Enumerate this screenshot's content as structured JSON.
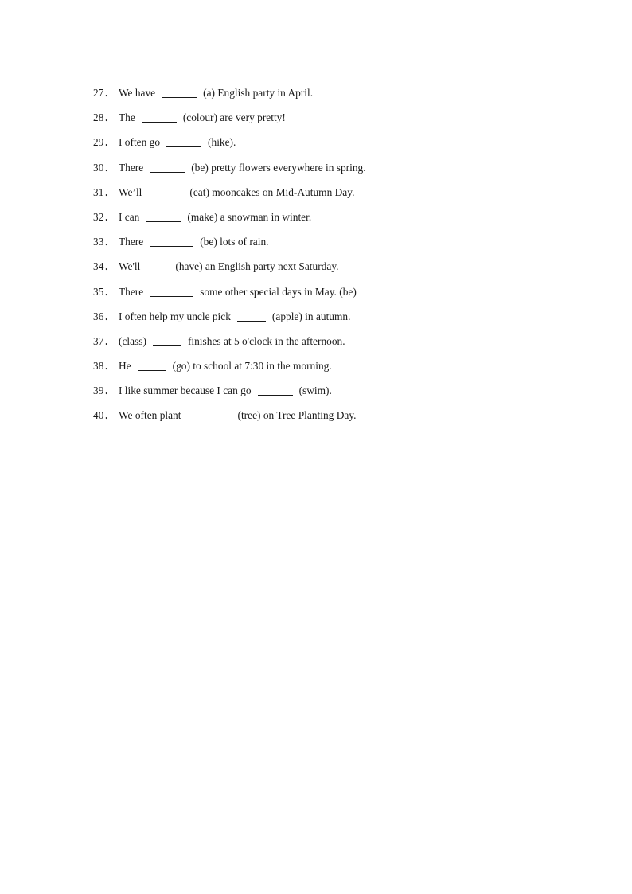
{
  "document": {
    "type": "worksheet",
    "page_background": "#ffffff",
    "text_color": "#1a1a1a",
    "exercises": [
      {
        "number": "27",
        "number_label": "27．",
        "before_blank": "We have",
        "blank_size": "lg",
        "after_blank": "(a) English party in April.",
        "full_text": "27．We have _____ (a) English party in April."
      },
      {
        "number": "28",
        "number_label": "28．",
        "before_blank": "The",
        "blank_size": "lg",
        "after_blank": "(colour) are very pretty!",
        "full_text": "28．The _____ (colour) are very pretty!"
      },
      {
        "number": "29",
        "number_label": "29．",
        "before_blank": "I often go",
        "blank_size": "lg",
        "after_blank": "(hike).",
        "full_text": "29．I often go _____ (hike)."
      },
      {
        "number": "30",
        "number_label": "30．",
        "before_blank": "There",
        "blank_size": "lg",
        "after_blank": "(be) pretty flowers everywhere in spring.",
        "full_text": "30．There _____ (be) pretty flowers everywhere in spring."
      },
      {
        "number": "31",
        "number_label": "31．",
        "before_blank": "We’ll",
        "blank_size": "lg",
        "after_blank": "(eat) mooncakes on Mid-Autumn Day.",
        "full_text": "31．We’ll _____ (eat) mooncakes on Mid-Autumn Day."
      },
      {
        "number": "32",
        "number_label": "32．",
        "before_blank": "I can",
        "blank_size": "lg",
        "after_blank": "(make) a snowman in winter.",
        "full_text": "32．I can _____ (make) a snowman in winter."
      },
      {
        "number": "33",
        "number_label": "33．",
        "before_blank": "There",
        "blank_size": "xl",
        "after_blank": "(be) lots of rain.",
        "full_text": "33．There _______ (be) lots of rain."
      },
      {
        "number": "34",
        "number_label": "34．",
        "before_blank": "We'll",
        "blank_size": "md",
        "after_blank": "(have) an English party next Saturday.",
        "no_gap_after_blank": true,
        "full_text": "34．We'll ____(have) an English party next Saturday."
      },
      {
        "number": "35",
        "number_label": "35．",
        "before_blank": "There",
        "blank_size": "xl",
        "after_blank": "some other special days in May. (be)",
        "full_text": "35．There _______ some other special days in May. (be)"
      },
      {
        "number": "36",
        "number_label": "36．",
        "before_blank": "I often help my uncle pick",
        "blank_size": "md",
        "after_blank": "(apple) in autumn.",
        "full_text": "36．I often help my uncle pick ____ (apple) in autumn."
      },
      {
        "number": "37",
        "number_label": "37．",
        "before_blank": "(class)",
        "blank_size": "md",
        "after_blank": "finishes at 5 o'clock in the afternoon.",
        "full_text": "37．(class) ____ finishes at 5 o'clock in the afternoon."
      },
      {
        "number": "38",
        "number_label": "38．",
        "before_blank": "He",
        "blank_size": "md",
        "after_blank": "(go) to school at 7:30 in the morning.",
        "full_text": "38．He ____ (go) to school at 7:30 in the morning."
      },
      {
        "number": "39",
        "number_label": "39．",
        "before_blank": "I like summer because I can go",
        "blank_size": "lg",
        "after_blank": "(swim).",
        "full_text": "39．I like summer because I can go _____ (swim)."
      },
      {
        "number": "40",
        "number_label": "40．",
        "before_blank": "We often plant",
        "blank_size": "xl",
        "after_blank": "(tree) on Tree Planting Day.",
        "full_text": "40．We often plant ________ (tree) on Tree Planting Day."
      }
    ]
  }
}
